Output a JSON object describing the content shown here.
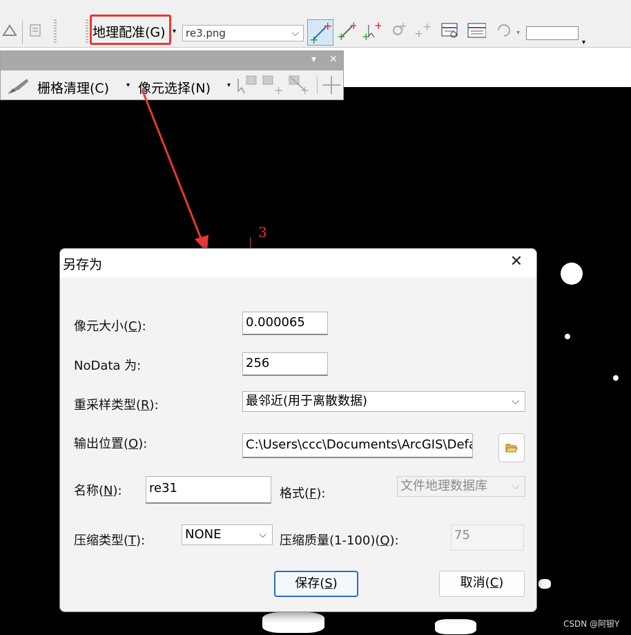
{
  "toolbar": {
    "georef_menu": "地理配准(G)",
    "layer_select": "re3.png"
  },
  "toolbar2": {
    "clean_menu": "栅格清理(C)",
    "pixel_menu": "像元选择(N)"
  },
  "annotation": {
    "map_label": "3"
  },
  "dialog": {
    "title": "另存为",
    "close": "✕",
    "cell_size": {
      "label_pre": "像元大小(",
      "key": "C",
      "label_post": "):",
      "value": "0.000065"
    },
    "nodata": {
      "label": "NoData 为:",
      "value": "256"
    },
    "resample": {
      "label_pre": "重采样类型(",
      "key": "R",
      "label_post": "):",
      "value": "最邻近(用于离散数据)"
    },
    "output": {
      "label_pre": "输出位置(",
      "key": "O",
      "label_post": "):",
      "value": "C:\\Users\\ccc\\Documents\\ArcGIS\\Defau"
    },
    "name": {
      "label_pre": "名称(",
      "key": "N",
      "label_post": "):",
      "value": "re31"
    },
    "format": {
      "label_pre": "格式(",
      "key": "F",
      "label_post": "):",
      "value": "文件地理数据库"
    },
    "compression": {
      "label_pre": "压缩类型(",
      "key": "T",
      "label_post": "):",
      "value": "NONE"
    },
    "quality": {
      "label_pre": "压缩质量(1-100)(",
      "key": "Q",
      "label_post": "):",
      "value": "75"
    },
    "save_pre": "保存(",
    "save_key": "S",
    "save_post": ")",
    "cancel_pre": "取消(",
    "cancel_key": "C",
    "cancel_post": ")"
  },
  "watermark": "CSDN @阿银Y"
}
